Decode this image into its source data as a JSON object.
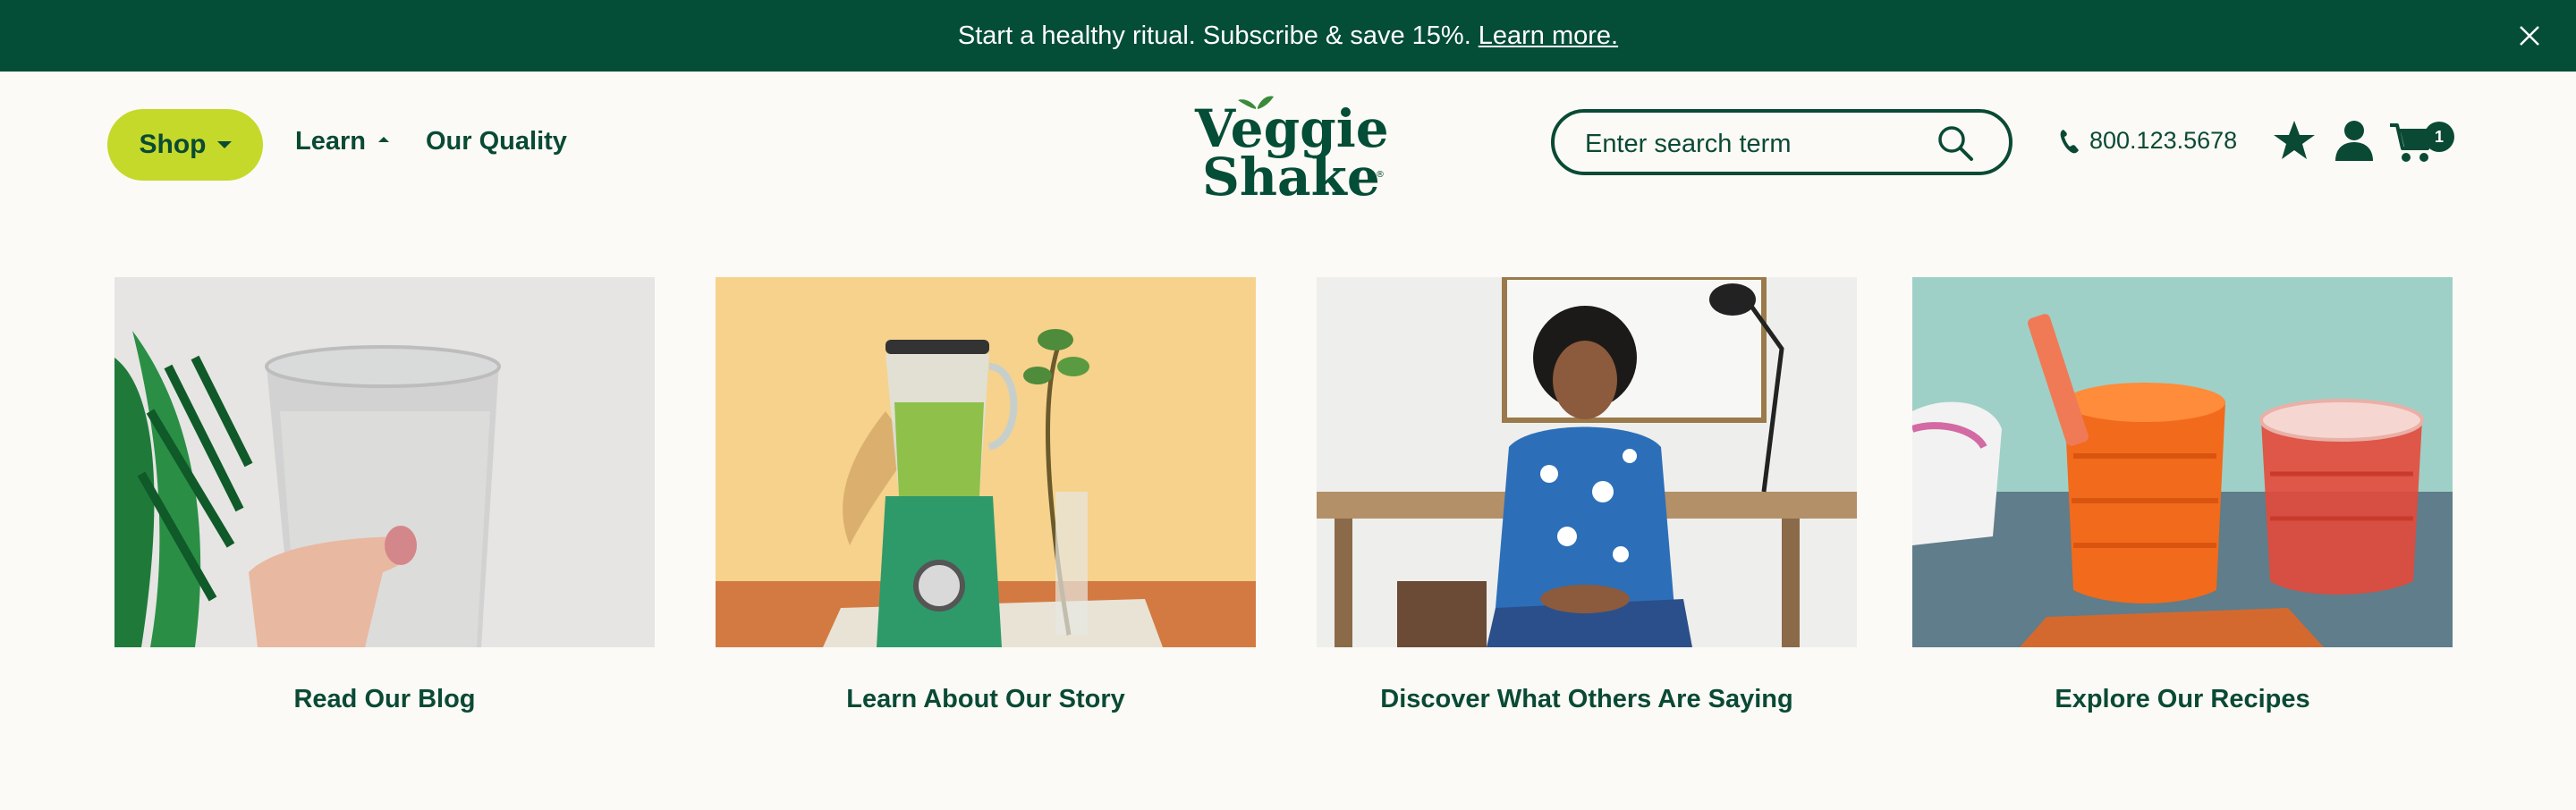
{
  "announcement": {
    "text": "Start a healthy ritual. Subscribe & save 15%.",
    "link": "Learn more.",
    "close_icon": "close-icon"
  },
  "nav": {
    "shop": "Shop",
    "learn": "Learn",
    "quality": "Our Quality"
  },
  "logo": {
    "line1": "Veggie",
    "line2": "Shake",
    "mark": "®"
  },
  "search": {
    "placeholder": "Enter search term",
    "value": ""
  },
  "contact": {
    "phone": "800.123.5678"
  },
  "header_icons": [
    "star-icon",
    "user-icon",
    "cart-icon"
  ],
  "cart": {
    "count": "1"
  },
  "cards": [
    {
      "caption": "Read Our Blog"
    },
    {
      "caption": "Learn About Our Story"
    },
    {
      "caption": "Discover What Others Are Saying"
    },
    {
      "caption": "Explore Our Recipes"
    }
  ],
  "colors": {
    "brand_green": "#044d36",
    "accent_lime": "#c4d92a",
    "background": "#fbfaf6"
  }
}
